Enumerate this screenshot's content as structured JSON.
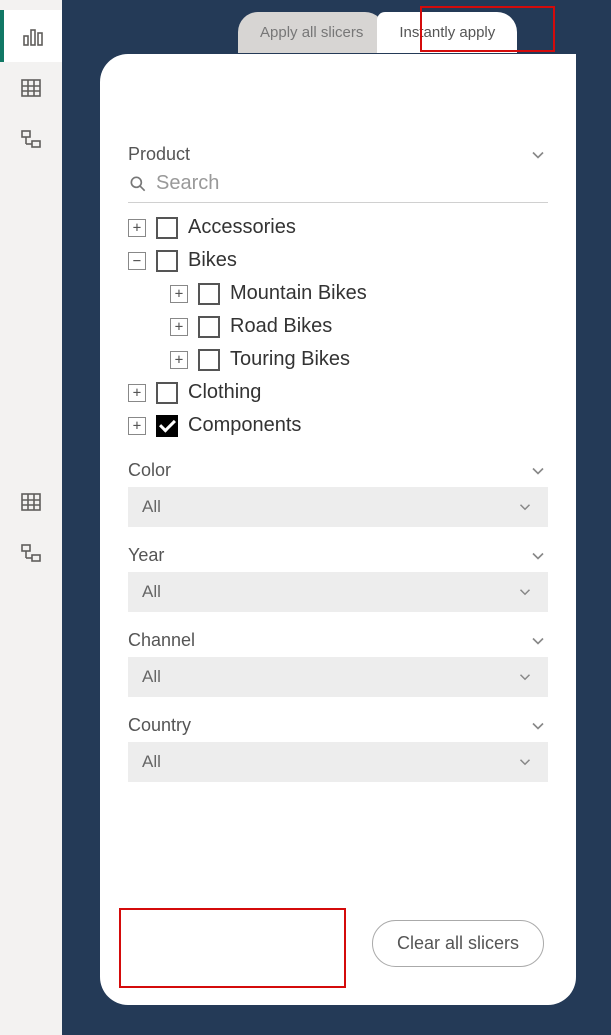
{
  "tabs": {
    "apply_all": "Apply all slicers",
    "instantly": "Instantly apply"
  },
  "product": {
    "title": "Product",
    "search_placeholder": "Search",
    "items": {
      "accessories": "Accessories",
      "bikes": "Bikes",
      "mountain": "Mountain Bikes",
      "road": "Road Bikes",
      "touring": "Touring Bikes",
      "clothing": "Clothing",
      "components": "Components"
    }
  },
  "dropdowns": {
    "color": {
      "label": "Color",
      "value": "All"
    },
    "year": {
      "label": "Year",
      "value": "All"
    },
    "channel": {
      "label": "Channel",
      "value": "All"
    },
    "country": {
      "label": "Country",
      "value": "All"
    }
  },
  "clear_button": "Clear all slicers"
}
